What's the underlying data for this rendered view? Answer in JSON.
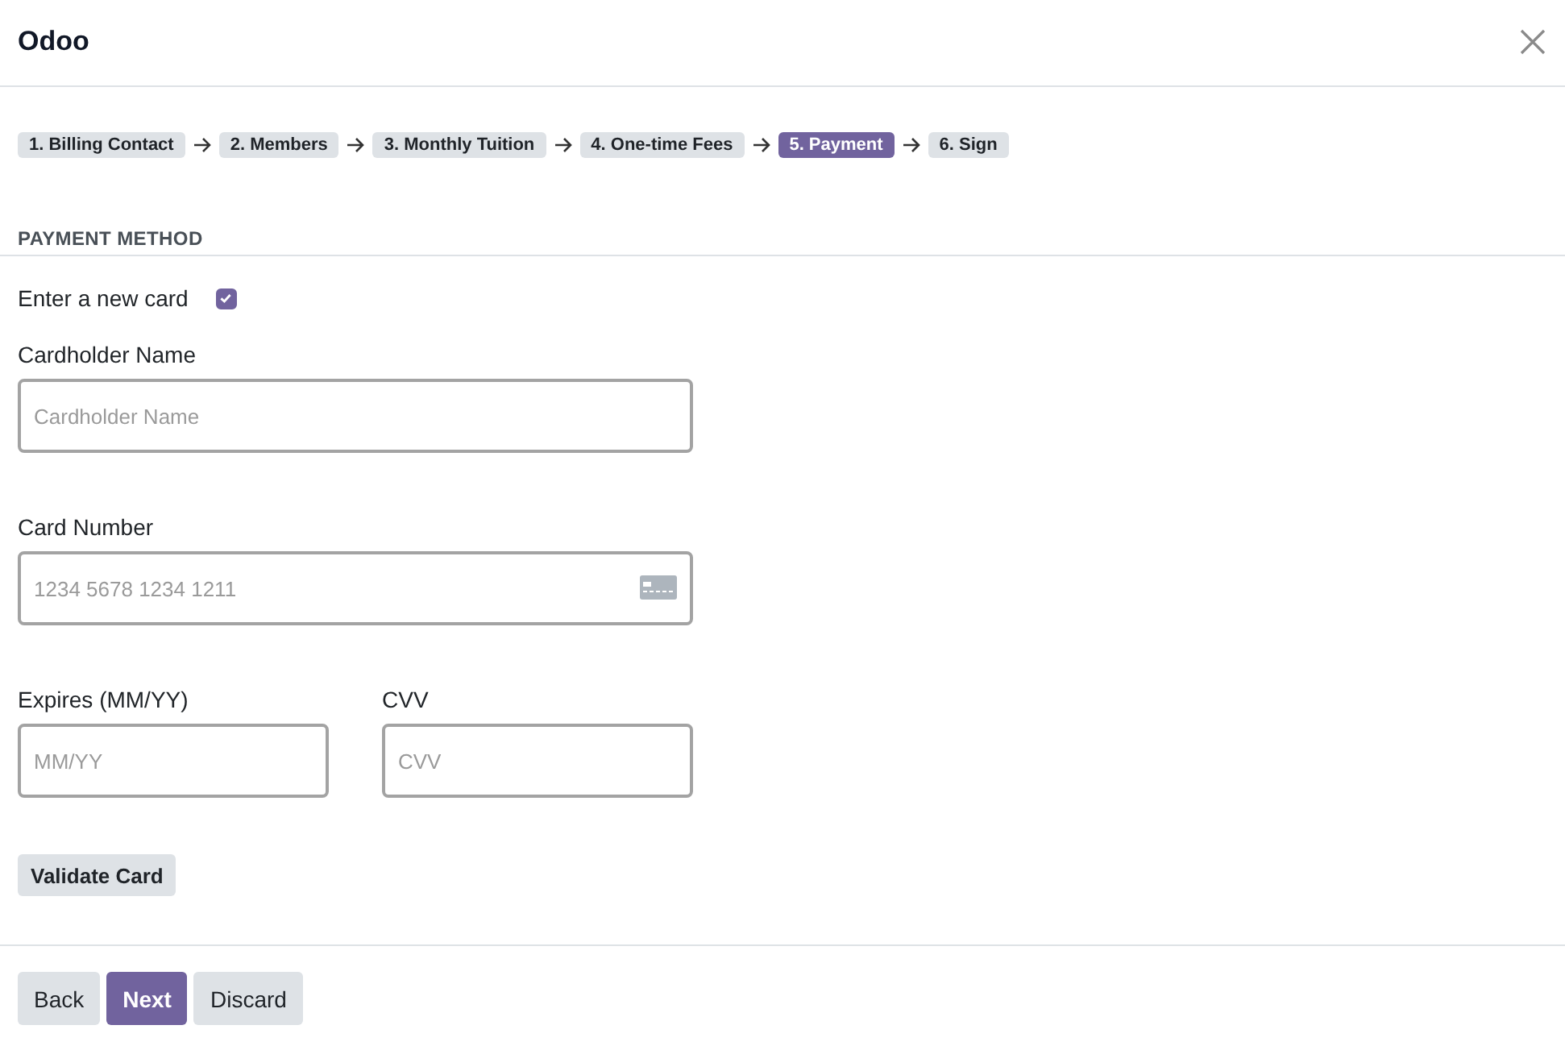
{
  "window": {
    "title": "Odoo"
  },
  "steps": [
    {
      "label": "1. Billing Contact",
      "selected": false
    },
    {
      "label": "2. Members",
      "selected": false
    },
    {
      "label": "3. Monthly Tuition",
      "selected": false
    },
    {
      "label": "4. One-time Fees",
      "selected": false
    },
    {
      "label": "5. Payment",
      "selected": true
    },
    {
      "label": "6. Sign",
      "selected": false
    }
  ],
  "section": {
    "title": "PAYMENT METHOD"
  },
  "new_card": {
    "label": "Enter a new card",
    "checked": true
  },
  "field_rows": [
    [
      {
        "label": "Cardholder Name",
        "placeholder": "Cardholder Name",
        "kind": "text"
      }
    ],
    [
      {
        "label": "Card Number",
        "placeholder": "1234 5678 1234 1211",
        "kind": "card_number"
      }
    ],
    [
      {
        "label": "Expires (MM/YY)",
        "placeholder": "MM/YY",
        "kind": "text"
      },
      {
        "label": "CVV",
        "placeholder": "CVV",
        "kind": "text"
      }
    ]
  ],
  "validate_button": {
    "label": "Validate Card"
  },
  "footer_buttons": [
    {
      "label": "Back",
      "kind": "secondary"
    },
    {
      "label": "Next",
      "kind": "primary"
    },
    {
      "label": "Discard",
      "kind": "secondary"
    }
  ]
}
